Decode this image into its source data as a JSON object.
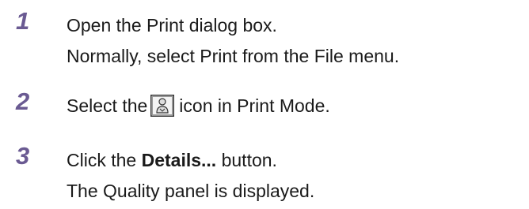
{
  "steps": [
    {
      "number": "1",
      "lines": [
        "Open the Print dialog box.",
        "Normally, select Print from the File menu."
      ]
    },
    {
      "number": "2",
      "prefix": "Select the",
      "icon": "print-mode-person-icon",
      "suffix": "icon in Print Mode."
    },
    {
      "number": "3",
      "prefix": "Click the",
      "bold": "Details...",
      "suffix": "button.",
      "line2": "The Quality panel is displayed."
    }
  ],
  "colors": {
    "step_number": "#6a5a92",
    "text": "#1a1a1a"
  }
}
